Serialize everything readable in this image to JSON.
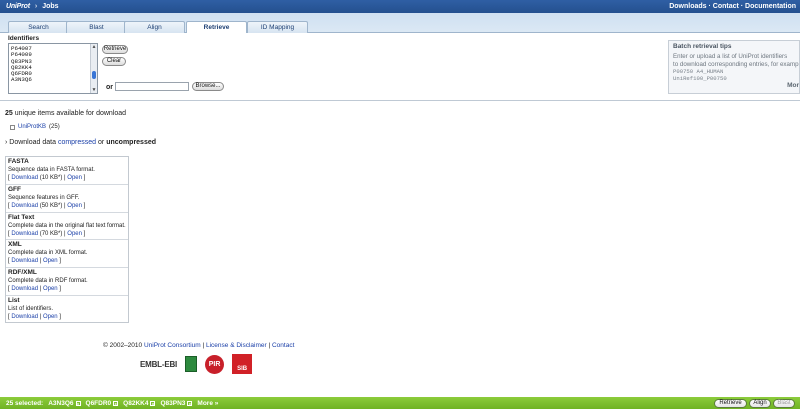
{
  "header": {
    "logo": "UniProt",
    "section": "Jobs",
    "links": "Downloads · Contact · Documentation"
  },
  "tabs": [
    "Search",
    "Blast",
    "Align",
    "Retrieve",
    "ID Mapping"
  ],
  "retrieve": {
    "identifiers_label": "Identifiers",
    "ids": [
      "P64007",
      "P64009",
      "Q83PN3",
      "Q82KK4",
      "Q6FDR0",
      "A3N3Q6"
    ],
    "retrieve_button": "Retrieve",
    "clear_button": "Clear",
    "or_label": "or",
    "browse_button": "Browse..."
  },
  "tips": {
    "title": "Batch retrieval tips",
    "line1": "Enter or upload a list of UniProt identifiers",
    "line2": "to download corresponding entries, for examp",
    "example1": "P00750 A4_HUMAN",
    "example2": "UniRef100_P00750",
    "more": "Mor"
  },
  "results": {
    "count": "25",
    "count_text": "unique items available for download",
    "db_link": "UniProtKB",
    "db_count": "(25)",
    "download_prefix": "› Download data",
    "compressed": "compressed",
    "or": "or",
    "uncompressed": "uncompressed"
  },
  "formats": [
    {
      "name": "FASTA",
      "desc": "Sequence data in FASTA format.",
      "size": "(10 KB*)"
    },
    {
      "name": "GFF",
      "desc": "Sequence features in GFF.",
      "size": "(50 KB*)"
    },
    {
      "name": "Flat Text",
      "desc": "Complete data in the original flat text format.",
      "size": "(70 KB*)"
    },
    {
      "name": "XML",
      "desc": "Complete data in XML format.",
      "size": ""
    },
    {
      "name": "RDF/XML",
      "desc": "Complete data in RDF format.",
      "size": ""
    },
    {
      "name": "List",
      "desc": "List of identifiers.",
      "size": ""
    }
  ],
  "links": {
    "download": "Download",
    "open": "Open"
  },
  "footer": {
    "copyright": "© 2002–2010",
    "consortium": "UniProt Consortium",
    "license": "License & Disclaimer",
    "contact": "Contact",
    "ebi": "EMBL-EBI",
    "pir": "PIR",
    "sib": "SIB"
  },
  "bottombar": {
    "selected": "25 selected:",
    "items": [
      "A3N3Q6",
      "Q6FDR0",
      "Q82KK4",
      "Q83PN3"
    ],
    "more": "More »",
    "retrieve": "Retrieve",
    "align": "Align",
    "blast": "Blast"
  }
}
